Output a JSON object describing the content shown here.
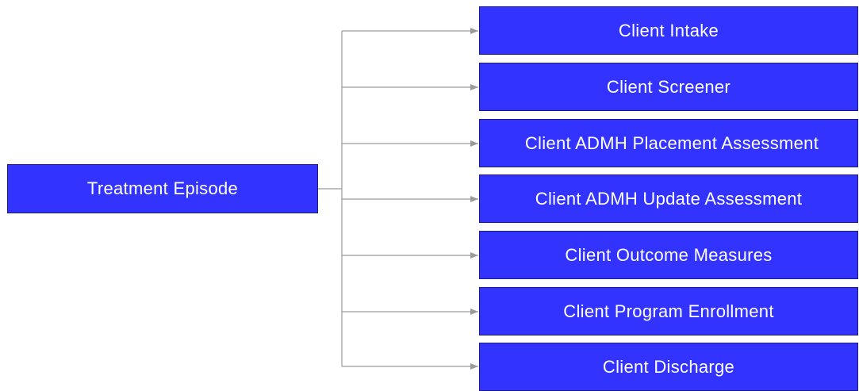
{
  "diagram": {
    "root": {
      "label": "Treatment Episode"
    },
    "children": [
      {
        "label": "Client Intake"
      },
      {
        "label": "Client Screener"
      },
      {
        "label": "Client ADMH Placement Assessment"
      },
      {
        "label": "Client ADMH Update Assessment"
      },
      {
        "label": "Client Outcome Measures"
      },
      {
        "label": "Client Program Enrollment"
      },
      {
        "label": "Client Discharge"
      }
    ],
    "colors": {
      "node_fill": "#3333ff",
      "node_border": "#1a1a80",
      "node_text": "#ffffff",
      "connector": "#9a9a9a"
    }
  }
}
